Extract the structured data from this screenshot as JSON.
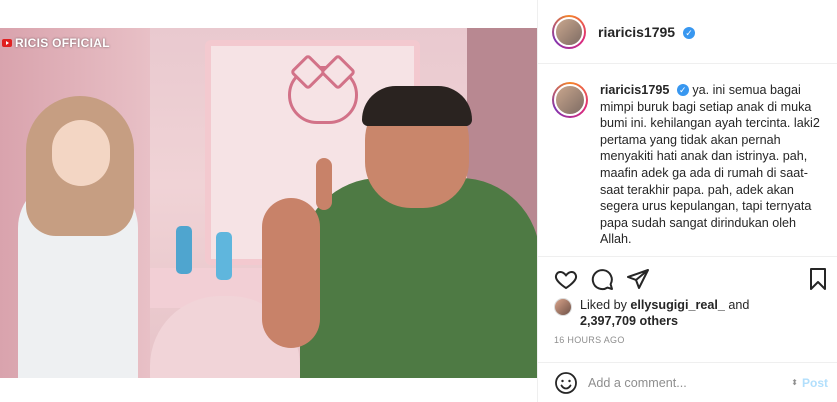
{
  "media": {
    "watermark": "RICIS OFFICIAL",
    "watermark_icon": "youtube-icon",
    "colors": {
      "wall": "#e9c9cf",
      "shirt": "#4e7a44",
      "hijab": "#c69e82"
    }
  },
  "post": {
    "username": "riaricis1795",
    "verified_icon": "verified-badge-icon",
    "caption": "ya. ini semua bagai mimpi buruk bagi setiap anak di muka bumi ini. kehilangan ayah tercinta. laki2 pertama yang tidak akan pernah menyakiti hati anak dan istrinya. pah, maafin adek ga ada di rumah di saat-saat terakhir papa. pah, adek akan segera urus kepulangan, tapi ternyata papa sudah sangat dirindukan oleh Allah."
  },
  "actions": {
    "like_icon": "heart-icon",
    "comment_icon": "comment-icon",
    "share_icon": "paper-plane-icon",
    "save_icon": "bookmark-icon"
  },
  "likes": {
    "prefix": "Liked by ",
    "first_liker": "ellysugigi_real_",
    "middle": " and",
    "count": "2,397,709 others"
  },
  "timestamp": "16 HOURS AGO",
  "comment": {
    "emoji_icon": "emoji-icon",
    "placeholder": "Add a comment...",
    "post_label": "Post",
    "post_color": "#b2dffc"
  }
}
